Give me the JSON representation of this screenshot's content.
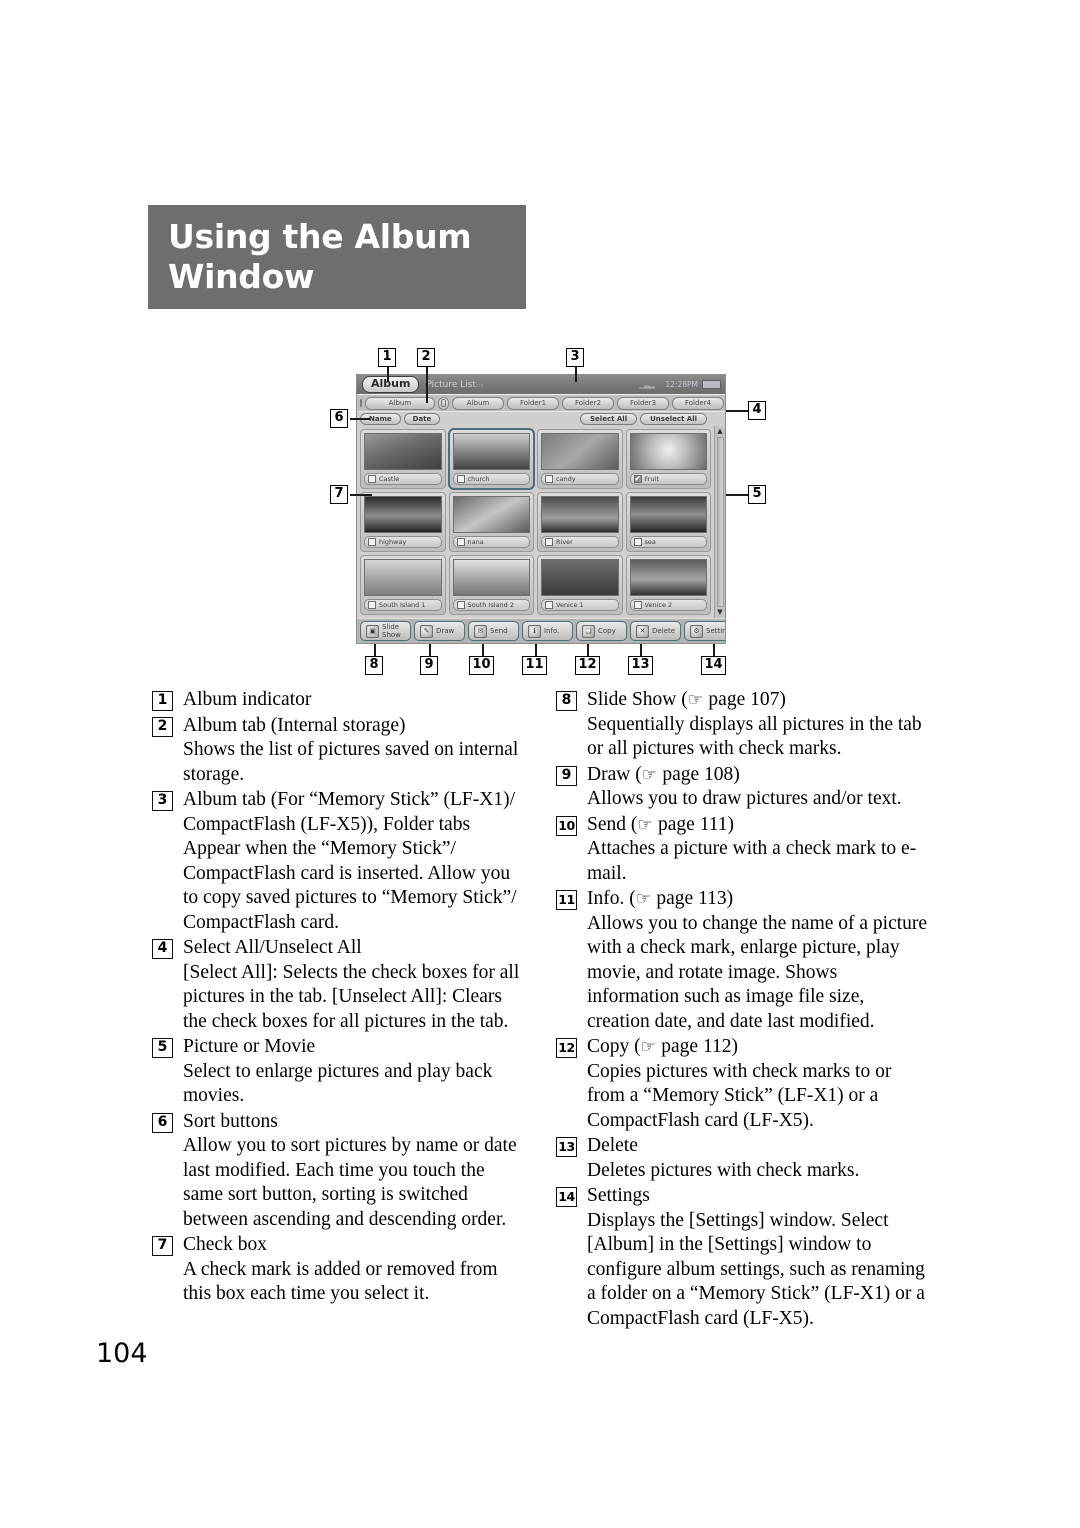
{
  "page": {
    "title_line1": "Using the Album",
    "title_line2": "Window",
    "number": "104"
  },
  "device": {
    "album_badge": "Album",
    "window_title": "Picture List",
    "status_time": "12:28PM",
    "battery_icon": "battery-icon",
    "internal_tab_label": "Album",
    "tabs": [
      {
        "label": "Album"
      },
      {
        "label": "Folder1"
      },
      {
        "label": "Folder2"
      },
      {
        "label": "Folder3"
      },
      {
        "label": "Folder4"
      }
    ],
    "sort_buttons": [
      {
        "label": "Name"
      },
      {
        "label": "Date"
      }
    ],
    "select_all": "Select All",
    "unselect_all": "Unselect All",
    "thumbnails": [
      {
        "label": "Castle",
        "checked": false,
        "selected": false
      },
      {
        "label": "church",
        "checked": false,
        "selected": true
      },
      {
        "label": "candy",
        "checked": false,
        "selected": false
      },
      {
        "label": "Fruit",
        "checked": true,
        "selected": false
      },
      {
        "label": "highway",
        "checked": false,
        "selected": false
      },
      {
        "label": "nana",
        "checked": false,
        "selected": false
      },
      {
        "label": "River",
        "checked": false,
        "selected": false
      },
      {
        "label": "sea",
        "checked": false,
        "selected": false
      },
      {
        "label": "South Island 1",
        "checked": false,
        "selected": false
      },
      {
        "label": "South Island 2",
        "checked": false,
        "selected": false
      },
      {
        "label": "Venice 1",
        "checked": false,
        "selected": false
      },
      {
        "label": "Venice 2",
        "checked": false,
        "selected": false
      }
    ],
    "toolbar": [
      {
        "label": "Slide Show",
        "icon": "slideshow-icon",
        "glyph": "▣"
      },
      {
        "label": "Draw",
        "icon": "draw-icon",
        "glyph": "✎"
      },
      {
        "label": "Send",
        "icon": "send-icon",
        "glyph": "✉"
      },
      {
        "label": "Info.",
        "icon": "info-icon",
        "glyph": "ℹ"
      },
      {
        "label": "Copy",
        "icon": "copy-icon",
        "glyph": "❏"
      },
      {
        "label": "Delete",
        "icon": "delete-icon",
        "glyph": "✕"
      },
      {
        "label": "Settings",
        "icon": "settings-icon",
        "glyph": "⚙"
      }
    ],
    "scroll_up": "▲",
    "scroll_down": "▼"
  },
  "callouts": [
    "1",
    "2",
    "3",
    "4",
    "5",
    "6",
    "7",
    "8",
    "9",
    "10",
    "11",
    "12",
    "13",
    "14"
  ],
  "legend": {
    "left": [
      {
        "num": "1",
        "title": "Album indicator",
        "desc": ""
      },
      {
        "num": "2",
        "title": "Album tab (Internal storage)",
        "desc": "Shows the list of pictures saved on internal storage."
      },
      {
        "num": "3",
        "title": "Album tab (For “Memory Stick” (LF-X1)/ CompactFlash (LF-X5)), Folder tabs",
        "desc": "Appear when the “Memory Stick”/ CompactFlash card is inserted. Allow you to copy saved pictures to “Memory Stick”/ CompactFlash card."
      },
      {
        "num": "4",
        "title": "Select All/Unselect All",
        "desc": "[Select All]: Selects the check boxes for all pictures in the tab. [Unselect All]: Clears the check boxes for all pictures in the tab."
      },
      {
        "num": "5",
        "title": "Picture or Movie",
        "desc": "Select to enlarge pictures and play back movies."
      },
      {
        "num": "6",
        "title": "Sort buttons",
        "desc": "Allow you to sort pictures by name or date last modified. Each time you touch the same sort button, sorting is switched between ascending and descending order."
      },
      {
        "num": "7",
        "title": "Check box",
        "desc": "A check mark is added or removed from this box each time you select it."
      }
    ],
    "right": [
      {
        "num": "8",
        "title": "Slide Show (",
        "ref": "page 107",
        "title_end": ")",
        "desc": "Sequentially displays all pictures in the tab or all pictures with check marks."
      },
      {
        "num": "9",
        "title": "Draw (",
        "ref": "page 108",
        "title_end": ")",
        "desc": "Allows you to draw pictures and/or text."
      },
      {
        "num": "10",
        "title": "Send (",
        "ref": "page 111",
        "title_end": ")",
        "desc": "Attaches a picture with a check mark to e-mail."
      },
      {
        "num": "11",
        "title": "Info. (",
        "ref": "page 113",
        "title_end": ")",
        "desc": "Allows you to change the name of a picture with a check mark, enlarge picture, play movie, and rotate image. Shows information such as image file size, creation date, and date last modified."
      },
      {
        "num": "12",
        "title": "Copy (",
        "ref": "page 112",
        "title_end": ")",
        "desc": "Copies pictures with check marks to or from a “Memory Stick” (LF-X1) or a CompactFlash card (LF-X5)."
      },
      {
        "num": "13",
        "title": "Delete",
        "ref": "",
        "title_end": "",
        "desc": "Deletes pictures with check marks."
      },
      {
        "num": "14",
        "title": "Settings",
        "ref": "",
        "title_end": "",
        "desc": "Displays the [Settings] window. Select [Album] in the [Settings] window to configure album settings, such as renaming a folder on a “Memory Stick” (LF-X1) or a CompactFlash card (LF-X5)."
      }
    ]
  }
}
